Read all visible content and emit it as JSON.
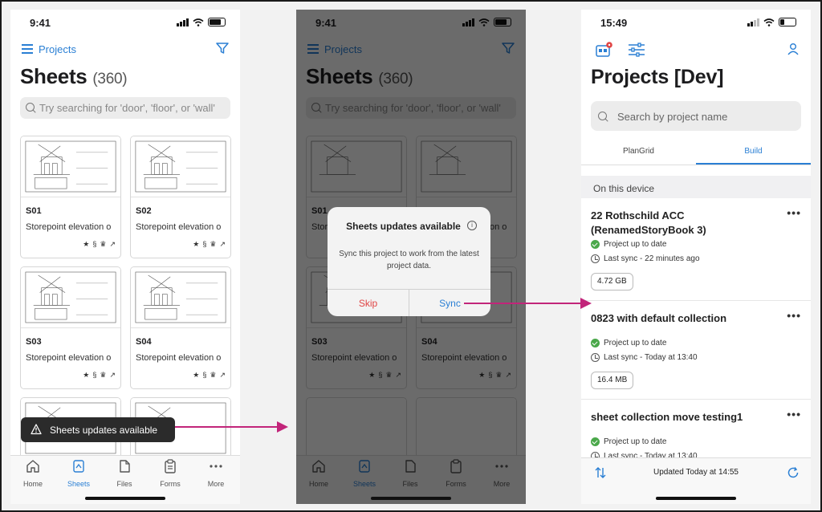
{
  "status": {
    "time_a": "9:41",
    "time_b": "15:49"
  },
  "sheets": {
    "back_label": "Projects",
    "title": "Sheets",
    "count": "(360)",
    "search_placeholder": "Try searching for 'door', 'floor', or 'wall'",
    "cards": [
      {
        "code": "S01",
        "desc": "Storepoint elevation o"
      },
      {
        "code": "S02",
        "desc": "Storepoint elevation o"
      },
      {
        "code": "S03",
        "desc": "Storepoint elevation o"
      },
      {
        "code": "S04",
        "desc": "Storepoint elevation o"
      }
    ],
    "toast": "Sheets updates available",
    "tabs": [
      {
        "label": "Home",
        "icon": "home-icon"
      },
      {
        "label": "Sheets",
        "icon": "sheets-icon",
        "active": true
      },
      {
        "label": "Files",
        "icon": "file-icon"
      },
      {
        "label": "Forms",
        "icon": "clipboard-icon"
      },
      {
        "label": "More",
        "icon": "more-icon"
      }
    ]
  },
  "dialog": {
    "title": "Sheets updates available",
    "message": "Sync this project to work from the latest project data.",
    "skip": "Skip",
    "sync": "Sync"
  },
  "projects": {
    "title": "Projects [Dev]",
    "search_placeholder": "Search by project name",
    "tabs": [
      "PlanGrid",
      "Build"
    ],
    "active_tab": "Build",
    "section": "On this device",
    "items": [
      {
        "name": "22 Rothschild ACC (RenamedStoryBook 3)",
        "status": "Project up to date",
        "sync": "Last sync - 22 minutes ago",
        "size": "4.72 GB"
      },
      {
        "name": "0823 with default collection",
        "status": "Project up to date",
        "sync": "Last sync - Today at 13:40",
        "size": "16.4 MB"
      },
      {
        "name": "sheet collection move testing1",
        "status": "Project up to date",
        "sync": "Last sync - Today at 13:40",
        "size": ""
      }
    ],
    "updated": "Updated Today at 14:55"
  },
  "colors": {
    "accent": "#2a7fd4",
    "arrow": "#c2257a",
    "skip": "#e04545",
    "ok": "#4aa84a"
  }
}
